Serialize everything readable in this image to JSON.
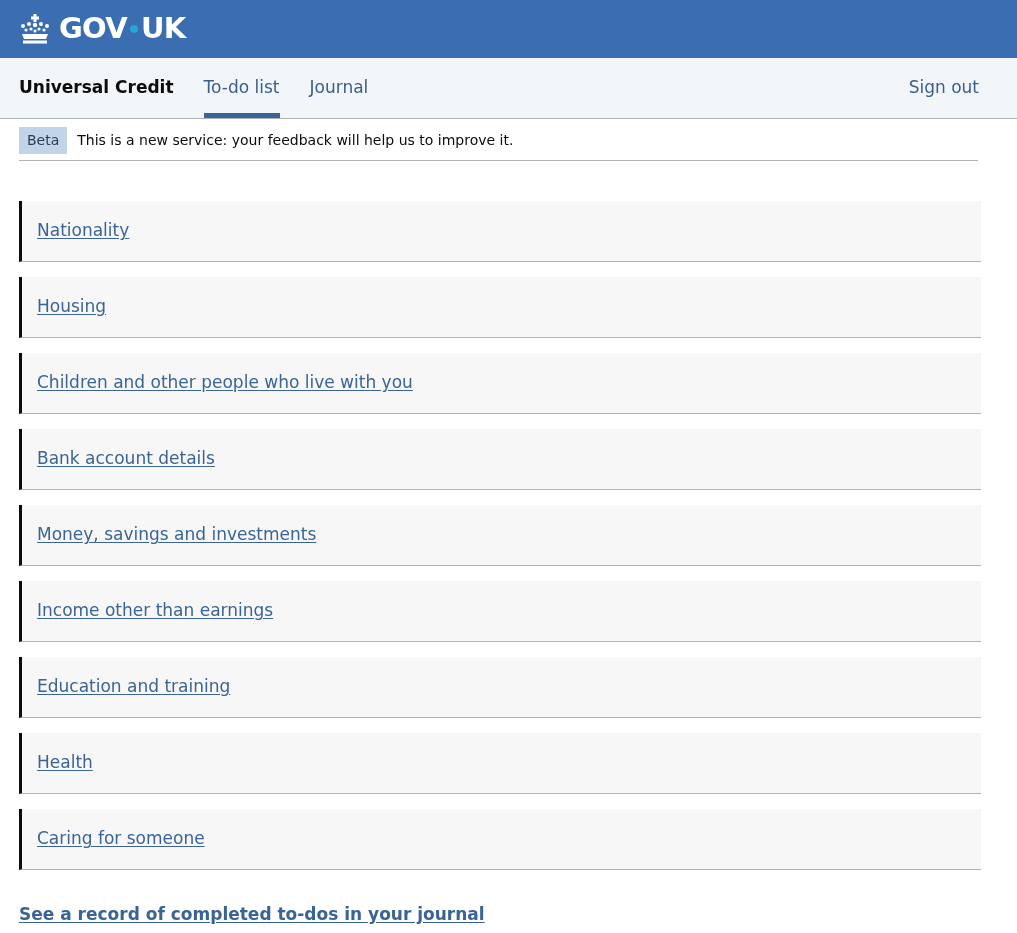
{
  "header": {
    "logo_left": "GOV",
    "logo_right": "UK"
  },
  "service_nav": {
    "service_name": "Universal Credit",
    "tabs": [
      {
        "label": "To-do list",
        "selected": true
      },
      {
        "label": "Journal",
        "selected": false
      }
    ],
    "sign_out": "Sign out"
  },
  "phase_banner": {
    "tag": "Beta",
    "text": "This is a new service: your feedback will help us to improve it."
  },
  "todo_items": [
    {
      "label": "Nationality"
    },
    {
      "label": "Housing"
    },
    {
      "label": "Children and other people who live with you"
    },
    {
      "label": "Bank account details"
    },
    {
      "label": "Money, savings and investments"
    },
    {
      "label": "Income other than earnings"
    },
    {
      "label": "Education and training"
    },
    {
      "label": "Health"
    },
    {
      "label": "Caring for someone"
    }
  ],
  "journal_link": "See a record of completed to-dos in your journal"
}
